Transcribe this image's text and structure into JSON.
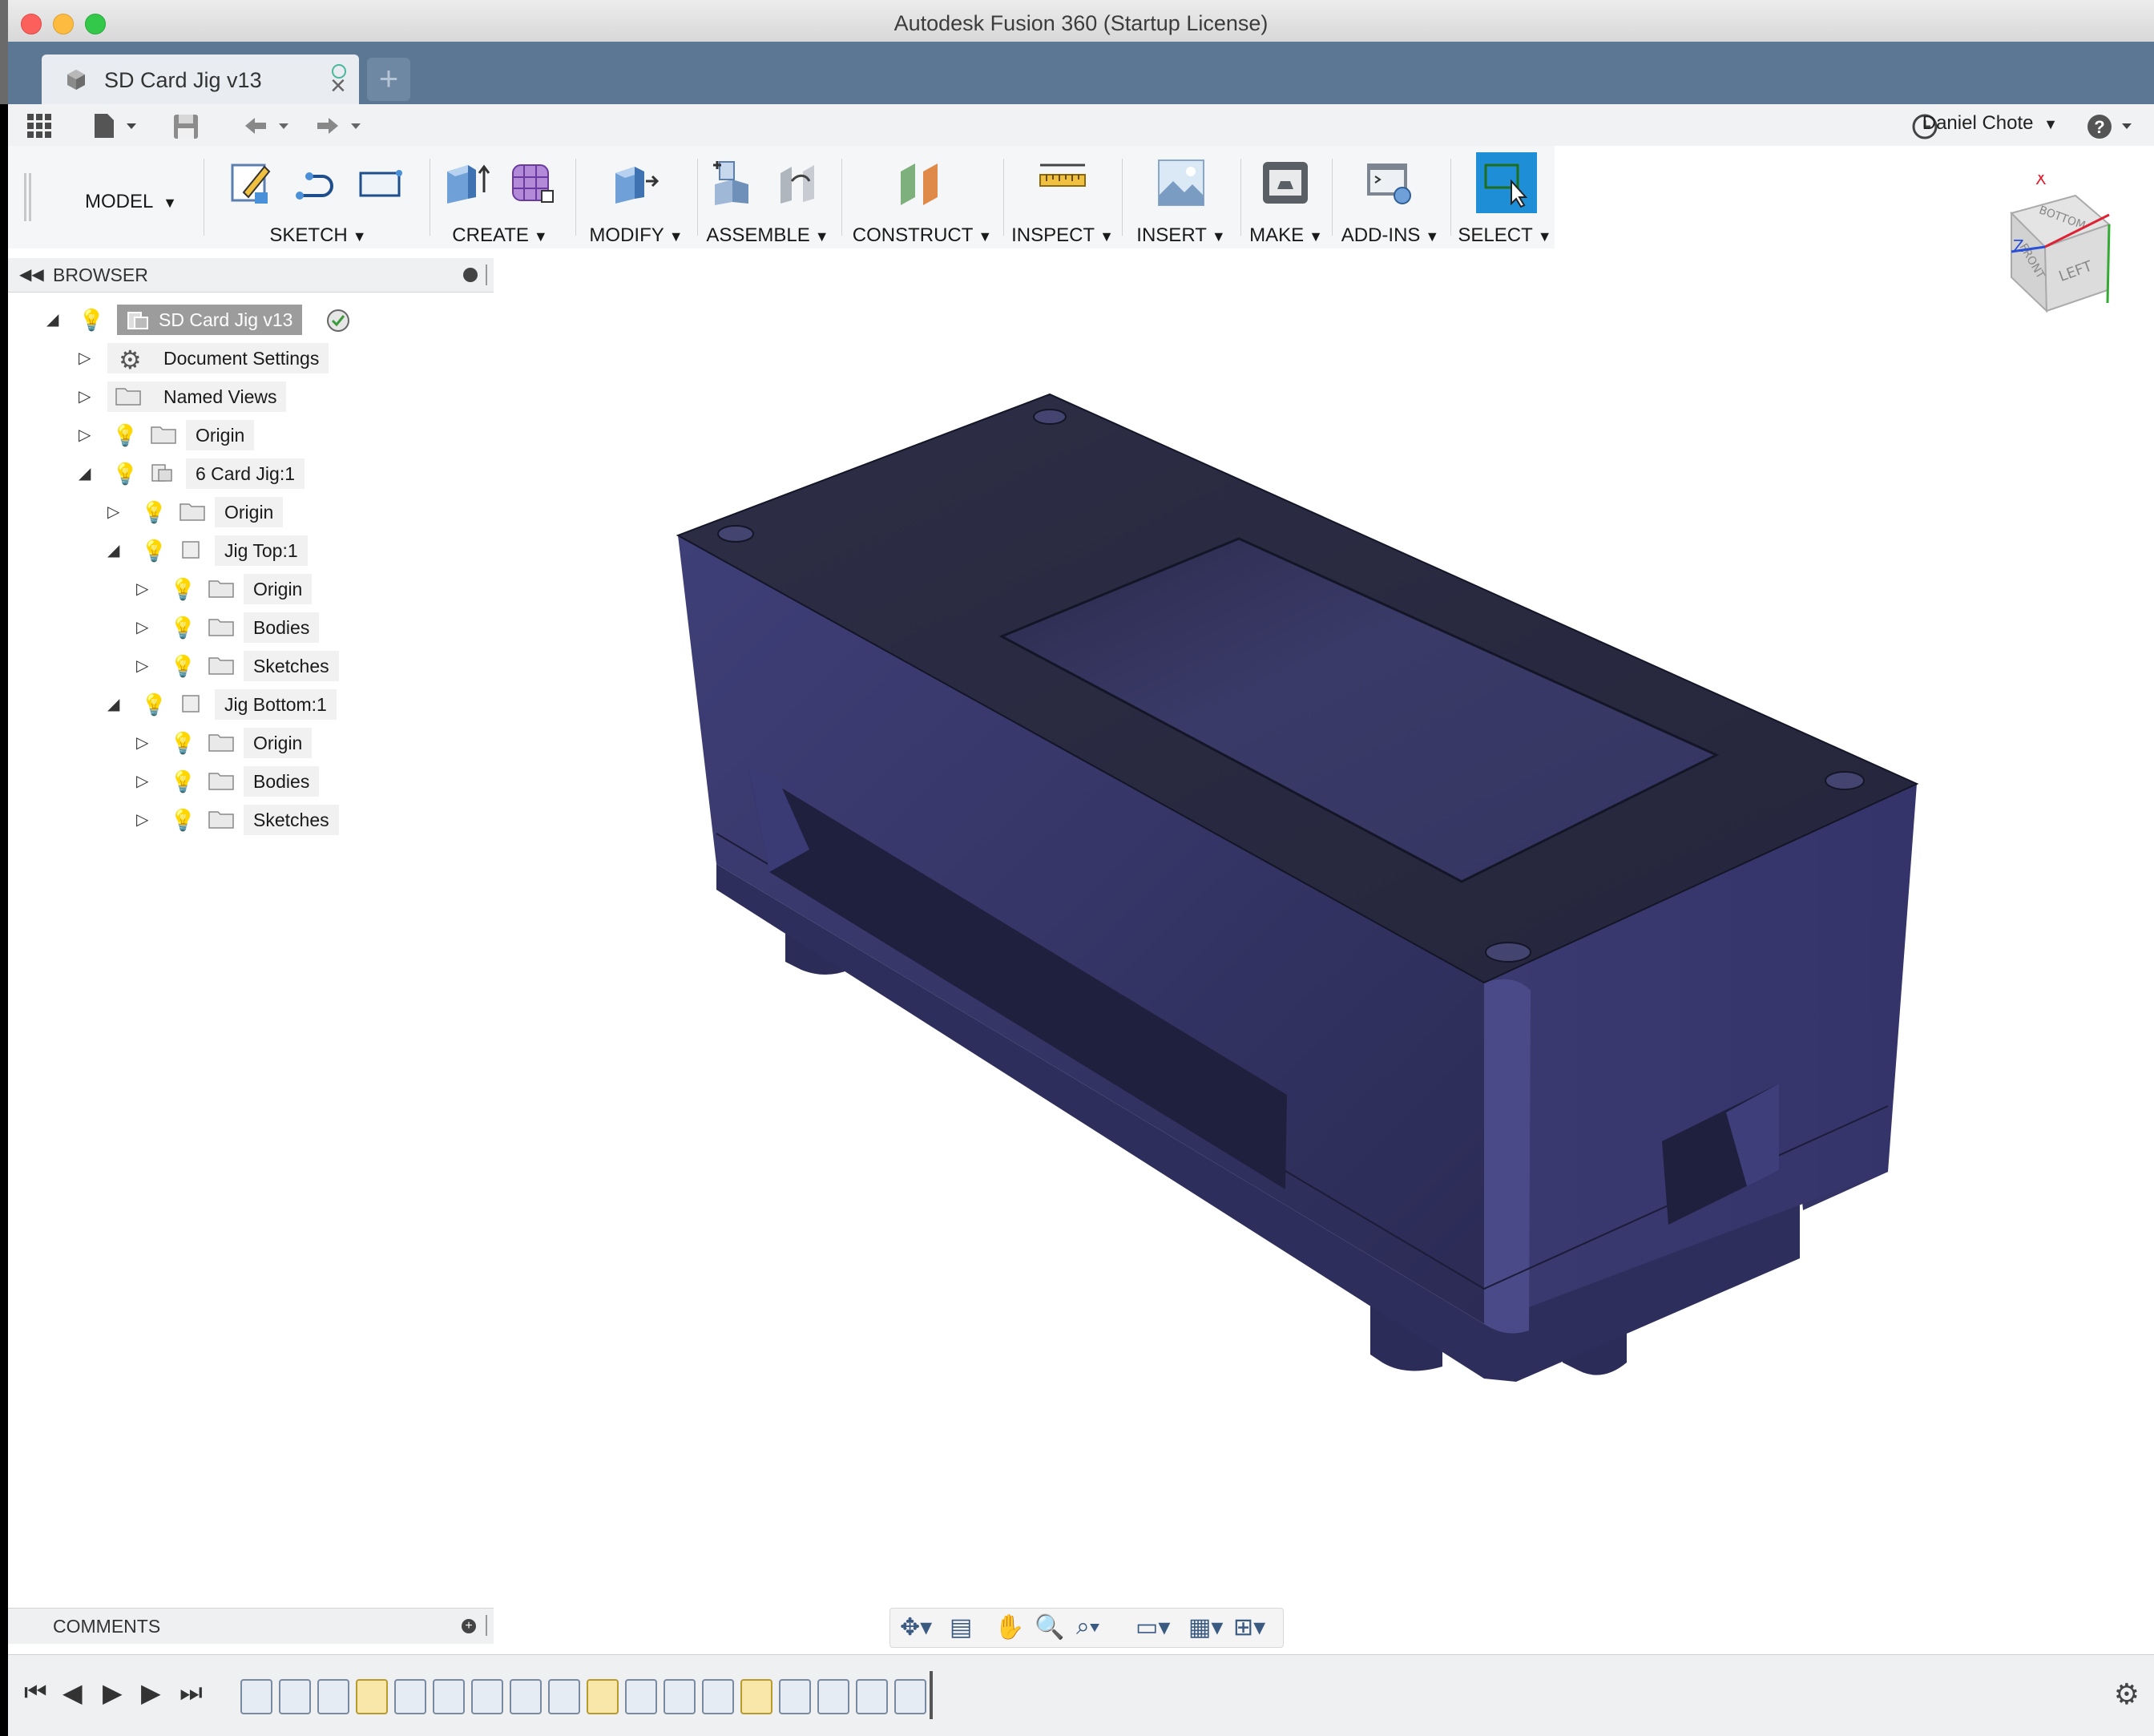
{
  "window": {
    "title": "Autodesk Fusion 360 (Startup License)"
  },
  "tab": {
    "name": "SD Card Jig v13"
  },
  "quickbar": {
    "user": "Daniel Chote"
  },
  "ribbon": {
    "workspace": "MODEL",
    "groups": [
      {
        "label": "SKETCH"
      },
      {
        "label": "CREATE"
      },
      {
        "label": "MODIFY"
      },
      {
        "label": "ASSEMBLE"
      },
      {
        "label": "CONSTRUCT"
      },
      {
        "label": "INSPECT"
      },
      {
        "label": "INSERT"
      },
      {
        "label": "MAKE"
      },
      {
        "label": "ADD-INS"
      },
      {
        "label": "SELECT"
      }
    ]
  },
  "browser": {
    "title": "BROWSER",
    "items": [
      {
        "label": "SD Card Jig v13"
      },
      {
        "label": "Document Settings"
      },
      {
        "label": "Named Views"
      },
      {
        "label": "Origin"
      },
      {
        "label": "6 Card Jig:1"
      },
      {
        "label": "Origin"
      },
      {
        "label": "Jig Top:1"
      },
      {
        "label": "Origin"
      },
      {
        "label": "Bodies"
      },
      {
        "label": "Sketches"
      },
      {
        "label": "Jig Bottom:1"
      },
      {
        "label": "Origin"
      },
      {
        "label": "Bodies"
      },
      {
        "label": "Sketches"
      }
    ]
  },
  "comments": {
    "title": "COMMENTS"
  },
  "viewcube": {
    "face_labels": [
      "LEFT",
      "BOTTOM",
      "FRONT"
    ],
    "axes": [
      "X",
      "Z"
    ]
  },
  "colors": {
    "model": "#3a3a6a",
    "tabbar": "#5c7794",
    "select_active": "#1e8fd6"
  },
  "icons": {
    "apps": "grid-icon",
    "file": "file-icon",
    "save": "save-icon",
    "undo": "undo-icon",
    "redo": "redo-icon",
    "history": "clock-icon",
    "help": "help-icon"
  }
}
